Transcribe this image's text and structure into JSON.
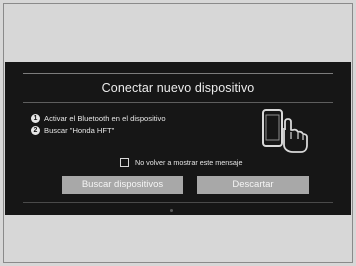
{
  "dialog": {
    "title": "Conectar nuevo dispositivo",
    "steps": [
      {
        "number": "1",
        "text": "Activar el Bluetooth en el dispositivo"
      },
      {
        "number": "2",
        "text": "Buscar \"Honda HFT\""
      }
    ],
    "checkbox": {
      "label": "No volver a mostrar este mensaje",
      "checked": false
    },
    "buttons": {
      "scan_label": "Buscar dispositivos",
      "dismiss_label": "Descartar"
    }
  },
  "icons": {
    "phone_touch": "phone-touch-icon"
  },
  "colors": {
    "screen_background": "#161616",
    "outer_background": "#d7d7d7",
    "button_background": "#a8a8a8",
    "text": "#e6e6e6"
  }
}
